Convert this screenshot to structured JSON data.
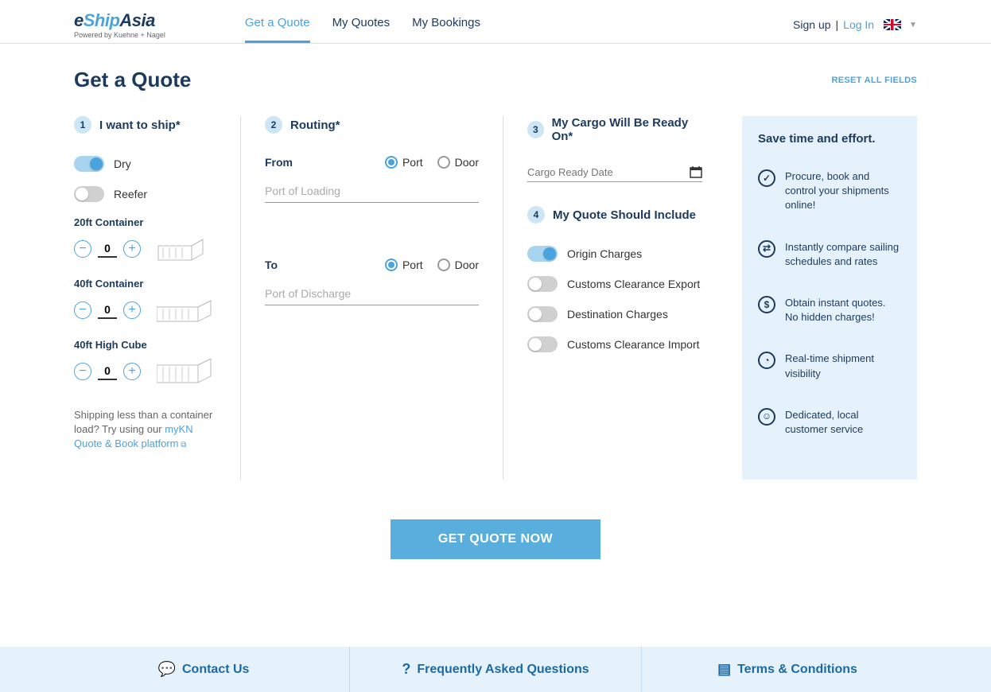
{
  "logo": {
    "prefix": "e",
    "mid": "Ship",
    "suffix": "Asia",
    "sub": "Powered by Kuehne + Nagel"
  },
  "nav": {
    "items": [
      "Get a Quote",
      "My Quotes",
      "My Bookings"
    ],
    "active": 0
  },
  "auth": {
    "signup": "Sign up",
    "sep": "|",
    "login": "Log In"
  },
  "page": {
    "title": "Get a Quote",
    "reset": "RESET ALL FIELDS"
  },
  "s1": {
    "title": "I want to ship*",
    "dry": "Dry",
    "reefer": "Reefer",
    "c20": "20ft Container",
    "c40": "40ft Container",
    "c40hc": "40ft High Cube",
    "v20": "0",
    "v40": "0",
    "v40hc": "0",
    "note_a": "Shipping less than a container load? Try using our ",
    "note_link": "myKN Quote & Book platform"
  },
  "s2": {
    "title": "Routing*",
    "from": "From",
    "to": "To",
    "port": "Port",
    "door": "Door",
    "ph_load": "Port of Loading",
    "ph_disch": "Port of Discharge"
  },
  "s3": {
    "title": "My Cargo Will Be Ready On*",
    "ph_date": "Cargo Ready Date"
  },
  "s4": {
    "title": "My Quote Should Include",
    "origin": "Origin Charges",
    "cexport": "Customs Clearance Export",
    "dest": "Destination Charges",
    "cimport": "Customs Clearance Import"
  },
  "promo": {
    "title": "Save time and effort.",
    "items": [
      "Procure, book and control your shipments online!",
      "Instantly compare sailing schedules and rates",
      "Obtain instant quotes. No hidden charges!",
      "Real-time shipment visibility",
      "Dedicated, local customer service"
    ]
  },
  "cta": "GET QUOTE NOW",
  "footer": {
    "contact": "Contact Us",
    "faq": "Frequently Asked Questions",
    "terms": "Terms & Conditions"
  }
}
